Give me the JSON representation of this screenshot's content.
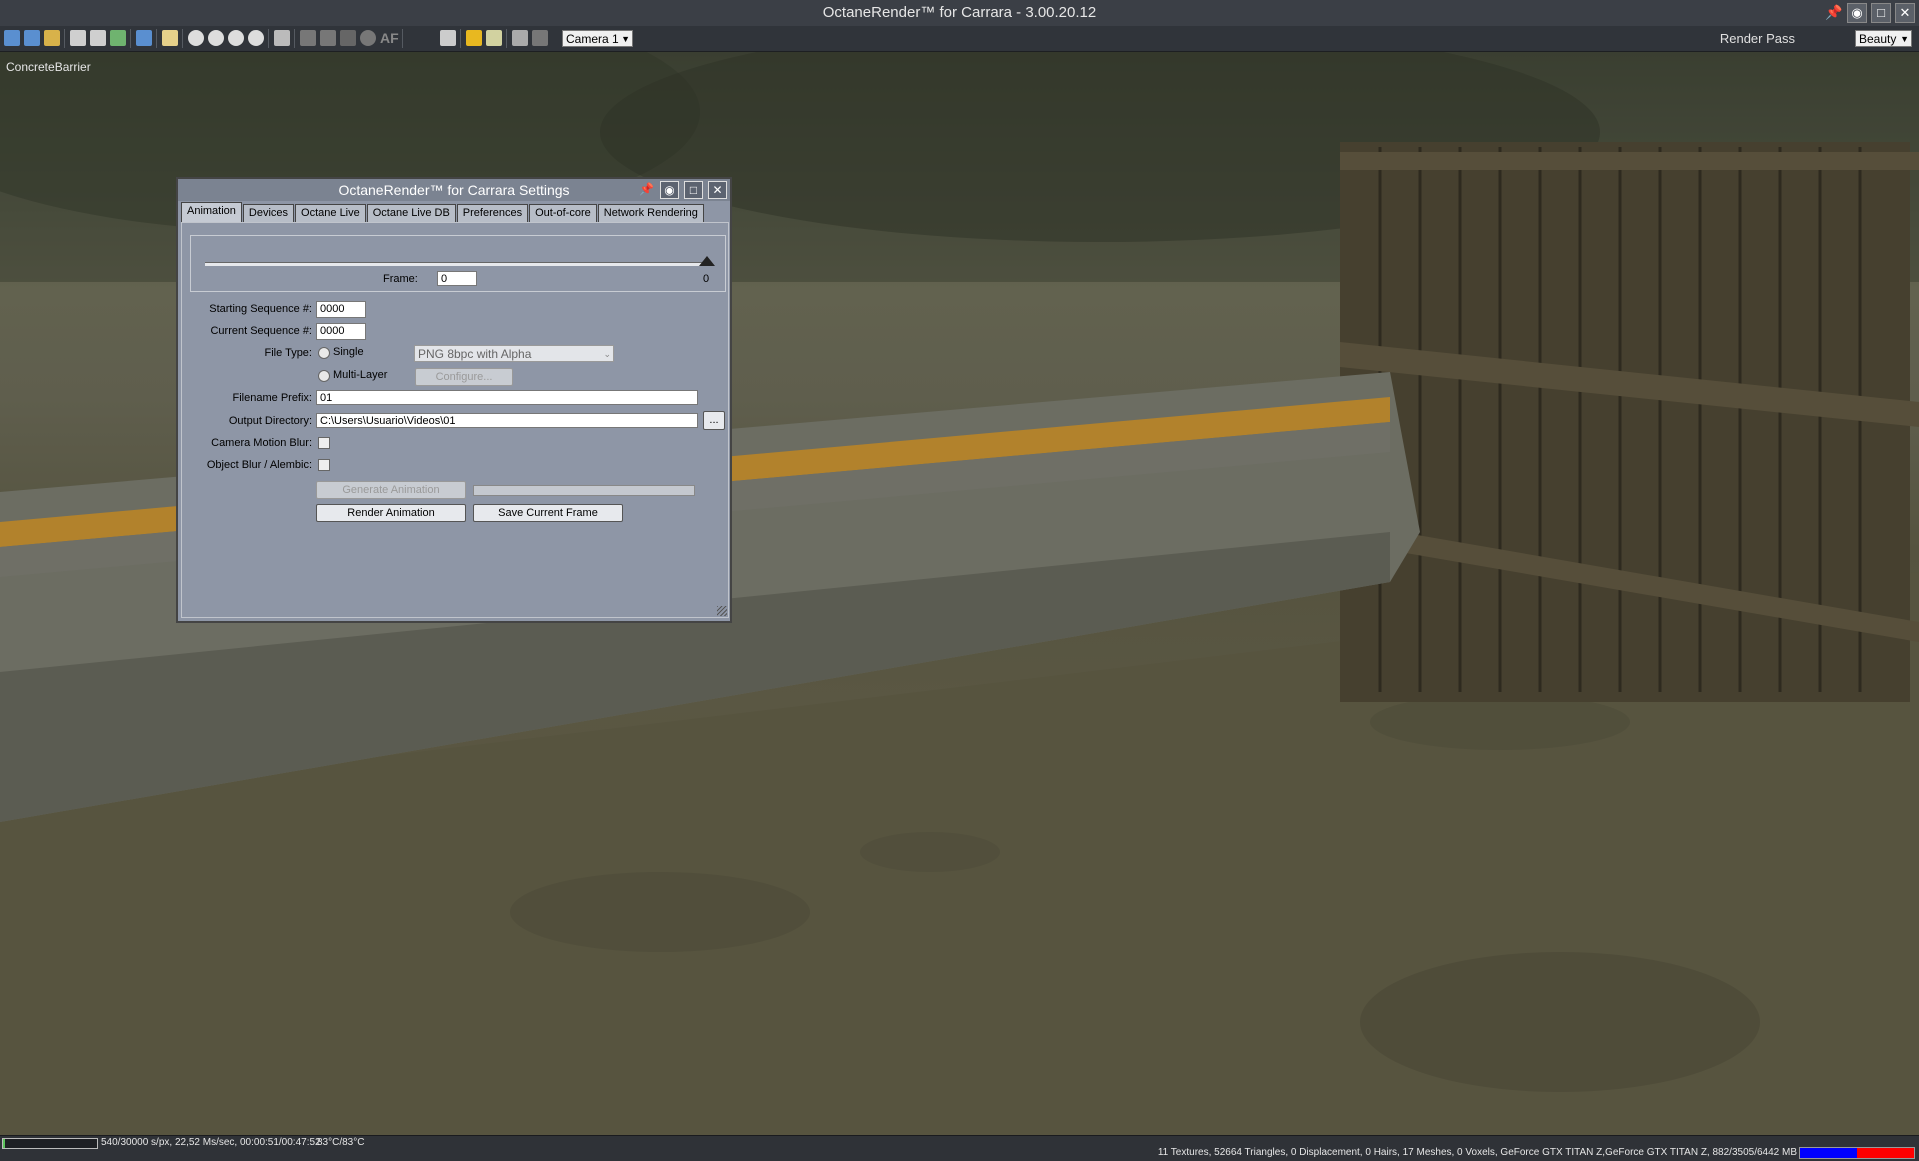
{
  "window": {
    "title": "OctaneRender™ for Carrara - 3.00.20.12"
  },
  "toolbar": {
    "camera_select": "Camera 1",
    "af_label": "AF",
    "render_pass_label": "Render Pass",
    "render_pass_value": "Beauty"
  },
  "viewport": {
    "object_label": "ConcreteBarrier"
  },
  "dialog": {
    "title": "OctaneRender™ for Carrara Settings",
    "tabs": [
      "Animation",
      "Devices",
      "Octane Live",
      "Octane Live DB",
      "Preferences",
      "Out-of-core",
      "Network Rendering"
    ],
    "active_tab": "Animation",
    "frame_label": "Frame:",
    "frame_value": "0",
    "frame_max": "0",
    "slider_position": 1.0,
    "starting_sequence_label": "Starting Sequence #:",
    "starting_sequence_value": "0000",
    "current_sequence_label": "Current Sequence #:",
    "current_sequence_value": "0000",
    "file_type_label": "File Type:",
    "single_label": "Single",
    "file_type_value": "PNG 8bpc with Alpha",
    "multilayer_label": "Multi-Layer",
    "configure_label": "Configure...",
    "filename_prefix_label": "Filename Prefix:",
    "filename_prefix_value": "01",
    "output_directory_label": "Output Directory:",
    "output_directory_value": "C:\\Users\\Usuario\\Videos\\01",
    "browse_label": "...",
    "camera_motion_blur_label": "Camera Motion Blur:",
    "object_blur_label": "Object Blur / Alembic:",
    "generate_animation_label": "Generate Animation",
    "render_animation_label": "Render Animation",
    "save_current_frame_label": "Save Current Frame"
  },
  "status": {
    "progress_fraction": 0.018,
    "progress_text": "540/30000  s/px, 22,52  Ms/sec, 00:00:51/00:47:52",
    "temperature": "83°C/83°C",
    "scene_info": "11 Textures, 52664 Triangles, 0 Displacement, 0 Hairs, 17 Meshes, 0 Voxels, GeForce GTX TITAN Z,GeForce GTX TITAN Z, 882/3505/6442 MB"
  },
  "colors": {
    "accent_pin": "#3aa0ff",
    "vram_used": "#0000ff",
    "vram_free": "#ff0000"
  }
}
